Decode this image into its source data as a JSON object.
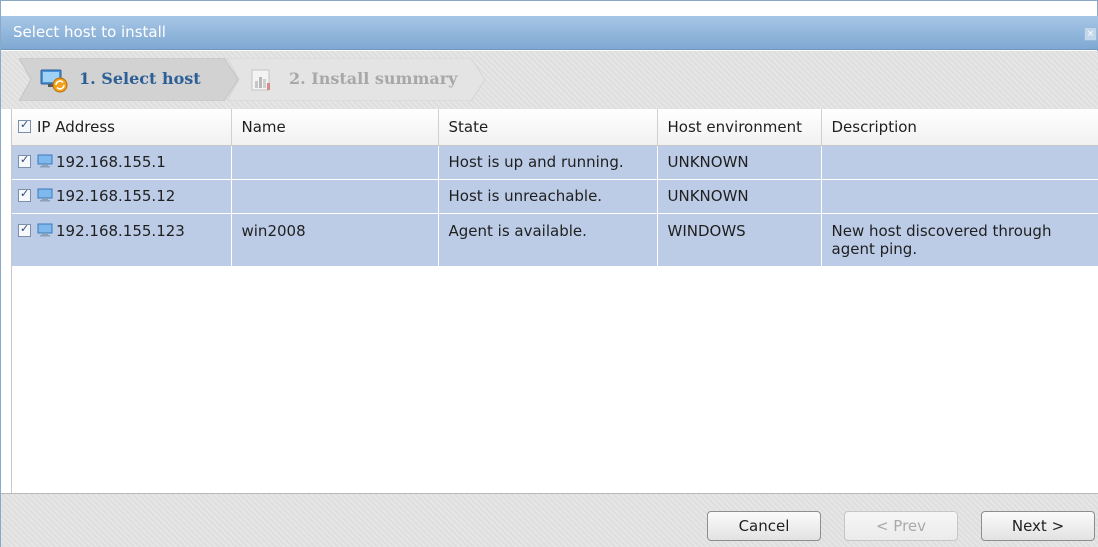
{
  "window": {
    "title": "Select host to install",
    "close_glyph": "×"
  },
  "wizard": {
    "steps": [
      {
        "label": "1. Select host",
        "icon": "select-host-icon",
        "active": true
      },
      {
        "label": "2. Install summary",
        "icon": "install-summary-icon",
        "active": false
      }
    ]
  },
  "table": {
    "columns": [
      "IP Address",
      "Name",
      "State",
      "Host environment",
      "Description"
    ],
    "rows": [
      {
        "checked": true,
        "ip": "192.168.155.1",
        "name": "",
        "state": "Host is up and running.",
        "env": "UNKNOWN",
        "description": ""
      },
      {
        "checked": true,
        "ip": "192.168.155.12",
        "name": "",
        "state": "Host is unreachable.",
        "env": "UNKNOWN",
        "description": ""
      },
      {
        "checked": true,
        "ip": "192.168.155.123",
        "name": "win2008",
        "state": "Agent is available.",
        "env": "WINDOWS",
        "description": "New host discovered through agent ping."
      }
    ]
  },
  "footer": {
    "cancel_label": "Cancel",
    "prev_label": "< Prev",
    "next_label": "Next >"
  },
  "colors": {
    "titlebar": "#8fb4dc",
    "selected_row": "#bccce7",
    "active_step_text": "#2b5f95",
    "inactive_step_text": "#a8a8a8"
  }
}
